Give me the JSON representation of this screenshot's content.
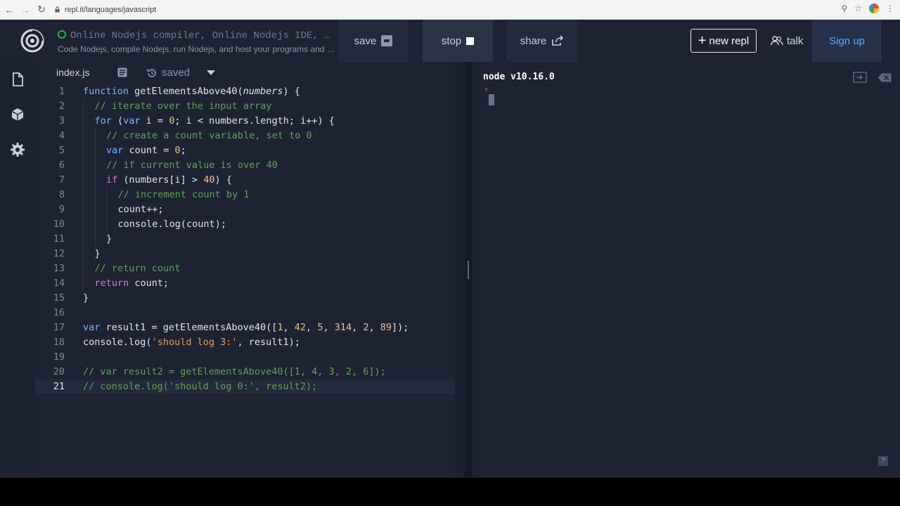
{
  "browser": {
    "url": "repl.it/languages/javascript"
  },
  "header": {
    "title": "Online Nodejs compiler, Online Nodejs IDE, a...",
    "subtitle": "Code Nodejs, compile Nodejs, run Nodejs, and host your programs and a...",
    "save_label": "save",
    "stop_label": "stop",
    "share_label": "share",
    "new_repl_label": "new repl",
    "talk_label": "talk",
    "signup_label": "Sign up"
  },
  "editor": {
    "tab_file": "index.js",
    "status": "saved",
    "lines": [
      {
        "n": "1",
        "indent": 0,
        "tokens": [
          [
            "kw",
            "function "
          ],
          [
            "fn",
            "getElementsAbove40"
          ],
          [
            "p",
            "("
          ],
          [
            "param",
            "numbers"
          ],
          [
            "p",
            ") {"
          ]
        ]
      },
      {
        "n": "2",
        "indent": 1,
        "tokens": [
          [
            "cm",
            "// iterate over the input array"
          ]
        ]
      },
      {
        "n": "3",
        "indent": 1,
        "tokens": [
          [
            "kw",
            "for "
          ],
          [
            "p",
            "("
          ],
          [
            "kw",
            "var "
          ],
          [
            "p",
            "i = "
          ],
          [
            "num",
            "0"
          ],
          [
            "p",
            "; i < numbers.length; i++) {"
          ]
        ]
      },
      {
        "n": "4",
        "indent": 2,
        "tokens": [
          [
            "cm",
            "// create a count variable, set to 0"
          ]
        ]
      },
      {
        "n": "5",
        "indent": 2,
        "tokens": [
          [
            "kw",
            "var "
          ],
          [
            "p",
            "count = "
          ],
          [
            "num",
            "0"
          ],
          [
            "p",
            ";"
          ]
        ]
      },
      {
        "n": "6",
        "indent": 2,
        "tokens": [
          [
            "cm",
            "// if current value is over 40"
          ]
        ]
      },
      {
        "n": "7",
        "indent": 2,
        "tokens": [
          [
            "kw2",
            "if "
          ],
          [
            "p",
            "(numbers[i] > "
          ],
          [
            "num",
            "40"
          ],
          [
            "p",
            ") {"
          ]
        ]
      },
      {
        "n": "8",
        "indent": 3,
        "tokens": [
          [
            "cm",
            "// increment count by 1"
          ]
        ]
      },
      {
        "n": "9",
        "indent": 3,
        "tokens": [
          [
            "p",
            "count++;"
          ]
        ]
      },
      {
        "n": "10",
        "indent": 3,
        "tokens": [
          [
            "p",
            "console."
          ],
          [
            "fn",
            "log"
          ],
          [
            "p",
            "(count);"
          ]
        ]
      },
      {
        "n": "11",
        "indent": 2,
        "tokens": [
          [
            "p",
            "}"
          ]
        ]
      },
      {
        "n": "12",
        "indent": 1,
        "tokens": [
          [
            "p",
            "}"
          ]
        ]
      },
      {
        "n": "13",
        "indent": 1,
        "tokens": [
          [
            "cm",
            "// return count"
          ]
        ]
      },
      {
        "n": "14",
        "indent": 1,
        "tokens": [
          [
            "kw2",
            "return "
          ],
          [
            "p",
            "count;"
          ]
        ]
      },
      {
        "n": "15",
        "indent": 0,
        "tokens": [
          [
            "p",
            "}"
          ]
        ]
      },
      {
        "n": "16",
        "indent": 0,
        "tokens": []
      },
      {
        "n": "17",
        "indent": 0,
        "tokens": [
          [
            "kw",
            "var "
          ],
          [
            "p",
            "result1 = "
          ],
          [
            "fn",
            "getElementsAbove40"
          ],
          [
            "p",
            "(["
          ],
          [
            "num",
            "1"
          ],
          [
            "p",
            ", "
          ],
          [
            "num",
            "42"
          ],
          [
            "p",
            ", "
          ],
          [
            "num",
            "5"
          ],
          [
            "p",
            ", "
          ],
          [
            "num",
            "314"
          ],
          [
            "p",
            ", "
          ],
          [
            "num",
            "2"
          ],
          [
            "p",
            ", "
          ],
          [
            "num",
            "89"
          ],
          [
            "p",
            "]);"
          ]
        ]
      },
      {
        "n": "18",
        "indent": 0,
        "tokens": [
          [
            "p",
            "console."
          ],
          [
            "fn",
            "log"
          ],
          [
            "p",
            "("
          ],
          [
            "str",
            "'should log 3:'"
          ],
          [
            "p",
            ", result1);"
          ]
        ]
      },
      {
        "n": "19",
        "indent": 0,
        "tokens": []
      },
      {
        "n": "20",
        "indent": 0,
        "tokens": [
          [
            "cm",
            "// var result2 = getElementsAbove40([1, 4, 3, 2, 6]);"
          ]
        ]
      },
      {
        "n": "21",
        "indent": 0,
        "active": true,
        "tokens": [
          [
            "cm",
            "// console.log('should log 0:', result2);"
          ]
        ]
      }
    ]
  },
  "console": {
    "version": "node v10.16.0",
    "prompt": "›",
    "help": "?"
  },
  "colors": {
    "accent_signup": "#4ab1ff",
    "keyword": "#7ab7ff",
    "comment": "#5fa55a",
    "prompt": "#e6553b"
  }
}
